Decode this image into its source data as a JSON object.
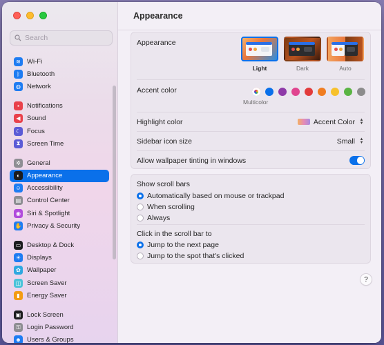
{
  "window": {
    "title": "Appearance"
  },
  "search": {
    "placeholder": "Search"
  },
  "sidebar": {
    "groups": [
      [
        {
          "label": "Wi-Fi",
          "icon": "wifi-icon",
          "color": "#1e7cf2"
        },
        {
          "label": "Bluetooth",
          "icon": "bluetooth-icon",
          "color": "#1e7cf2"
        },
        {
          "label": "Network",
          "icon": "network-globe-icon",
          "color": "#1e7cf2"
        }
      ],
      [
        {
          "label": "Notifications",
          "icon": "notifications-bell-icon",
          "color": "#e9414b"
        },
        {
          "label": "Sound",
          "icon": "speaker-icon",
          "color": "#e9414b"
        },
        {
          "label": "Focus",
          "icon": "moon-icon",
          "color": "#5b5bd6"
        },
        {
          "label": "Screen Time",
          "icon": "hourglass-icon",
          "color": "#5b5bd6"
        }
      ],
      [
        {
          "label": "General",
          "icon": "gear-icon",
          "color": "#8e8e93"
        },
        {
          "label": "Appearance",
          "icon": "appearance-circle-icon",
          "color": "#1c1c1e",
          "selected": true
        },
        {
          "label": "Accessibility",
          "icon": "accessibility-icon",
          "color": "#1e7cf2"
        },
        {
          "label": "Control Center",
          "icon": "control-center-icon",
          "color": "#8e8e93"
        },
        {
          "label": "Siri & Spotlight",
          "icon": "siri-icon",
          "color": "#b14bdc"
        },
        {
          "label": "Privacy & Security",
          "icon": "hand-icon",
          "color": "#1e7cf2"
        }
      ],
      [
        {
          "label": "Desktop & Dock",
          "icon": "dock-icon",
          "color": "#1c1c1e"
        },
        {
          "label": "Displays",
          "icon": "sun-icon",
          "color": "#1e7cf2"
        },
        {
          "label": "Wallpaper",
          "icon": "wallpaper-icon",
          "color": "#2fa8e0"
        },
        {
          "label": "Screen Saver",
          "icon": "screen-saver-icon",
          "color": "#4ac3d9"
        },
        {
          "label": "Energy Saver",
          "icon": "battery-icon",
          "color": "#f39c12"
        }
      ],
      [
        {
          "label": "Lock Screen",
          "icon": "lock-screen-icon",
          "color": "#1c1c1e"
        },
        {
          "label": "Login Password",
          "icon": "lock-icon",
          "color": "#8e8e93"
        },
        {
          "label": "Users & Groups",
          "icon": "users-icon",
          "color": "#1e7cf2"
        }
      ]
    ]
  },
  "appearance": {
    "label": "Appearance",
    "options": [
      {
        "label": "Light",
        "selected": true
      },
      {
        "label": "Dark",
        "selected": false
      },
      {
        "label": "Auto",
        "selected": false
      }
    ]
  },
  "accent": {
    "label": "Accent color",
    "caption": "Multicolor",
    "colors": [
      "multicolor",
      "#0a70ea",
      "#8e3aa8",
      "#e0448f",
      "#e23b3b",
      "#f07d21",
      "#f7c12c",
      "#5ab443",
      "#8c8c8c"
    ]
  },
  "highlight": {
    "label": "Highlight color",
    "value": "Accent Color"
  },
  "sidebar_icon_size": {
    "label": "Sidebar icon size",
    "value": "Small"
  },
  "wallpaper_tinting": {
    "label": "Allow wallpaper tinting in windows",
    "enabled": true
  },
  "scroll_bars": {
    "label": "Show scroll bars",
    "options": [
      {
        "label": "Automatically based on mouse or trackpad",
        "selected": true
      },
      {
        "label": "When scrolling",
        "selected": false
      },
      {
        "label": "Always",
        "selected": false
      }
    ]
  },
  "click_scroll": {
    "label": "Click in the scroll bar to",
    "options": [
      {
        "label": "Jump to the next page",
        "selected": true
      },
      {
        "label": "Jump to the spot that's clicked",
        "selected": false
      }
    ]
  },
  "help": {
    "label": "?"
  }
}
